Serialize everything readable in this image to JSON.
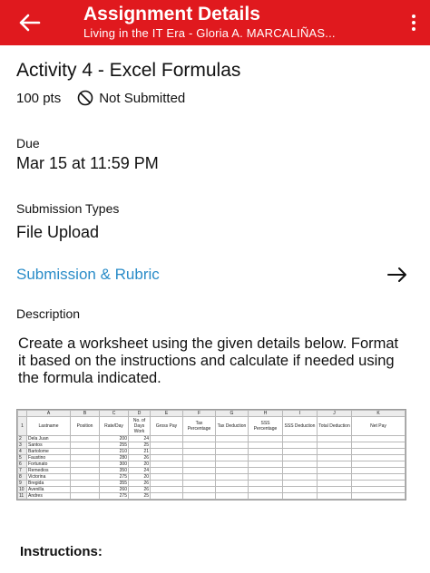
{
  "topbar": {
    "title": "Assignment Details",
    "subtitle": "Living in the IT Era - Gloria A. MARCALIÑAS...",
    "bg_color": "#e0191e",
    "back_icon": "arrow-left-icon",
    "more_icon": "more-vertical-icon"
  },
  "assignment": {
    "title": "Activity 4 - Excel Formulas",
    "points": "100 pts",
    "status": "Not Submitted",
    "status_icon": "not-submitted-icon"
  },
  "due": {
    "label": "Due",
    "value": "Mar 15 at 11:59 PM"
  },
  "submission": {
    "label": "Submission Types",
    "value": "File Upload"
  },
  "rubric": {
    "label": "Submission & Rubric",
    "icon": "arrow-right-icon",
    "color": "#2a8cc8"
  },
  "description": {
    "label": "Description",
    "text": "Create a worksheet using the given details below.  Format it based on the instructions and calculate if needed using the formula indicated."
  },
  "spreadsheet": {
    "col_letters": [
      "A",
      "B",
      "C",
      "D",
      "E",
      "F",
      "G",
      "H",
      "I",
      "J",
      "K"
    ],
    "headers": [
      "Lastname",
      "Position",
      "Rate/Day",
      "No. of Days Work",
      "Gross Pay",
      "Tax Percentage",
      "Tax Deduction",
      "SSS Percentage",
      "SSS Deduction",
      "Total Deduction",
      "Net Pay"
    ],
    "rows": [
      {
        "n": "2",
        "name": "Dela Juan",
        "rate": "200",
        "days": "24"
      },
      {
        "n": "3",
        "name": "Santos",
        "rate": "255",
        "days": "25"
      },
      {
        "n": "4",
        "name": "Bartolome",
        "rate": "210",
        "days": "21"
      },
      {
        "n": "5",
        "name": "Faustino",
        "rate": "280",
        "days": "26"
      },
      {
        "n": "6",
        "name": "Fortunato",
        "rate": "300",
        "days": "20"
      },
      {
        "n": "7",
        "name": "Remedios",
        "rate": "350",
        "days": "24"
      },
      {
        "n": "8",
        "name": "Victorina",
        "rate": "275",
        "days": "20"
      },
      {
        "n": "9",
        "name": "Bregida",
        "rate": "355",
        "days": "26"
      },
      {
        "n": "10",
        "name": "Avenilla",
        "rate": "260",
        "days": "26"
      },
      {
        "n": "11",
        "name": "Andres",
        "rate": "275",
        "days": "25"
      }
    ]
  },
  "instructions": {
    "label": "Instructions:"
  }
}
